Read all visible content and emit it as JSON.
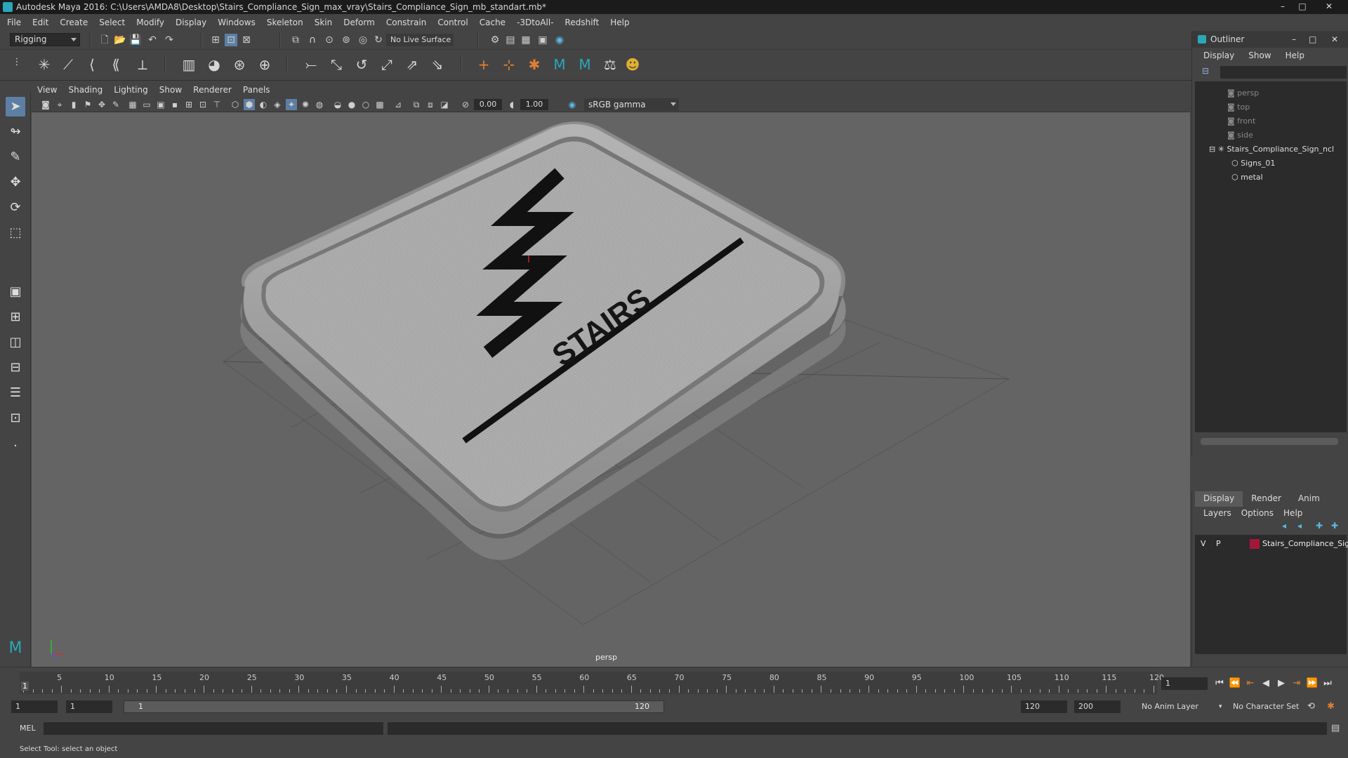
{
  "titlebar": {
    "title": "Autodesk Maya 2016: C:\\Users\\AMDA8\\Desktop\\Stairs_Compliance_Sign_max_vray\\Stairs_Compliance_Sign_mb_standart.mb*",
    "minimize": "–",
    "maximize": "□",
    "close": "✕"
  },
  "menubar": [
    "File",
    "Edit",
    "Create",
    "Select",
    "Modify",
    "Display",
    "Windows",
    "Skeleton",
    "Skin",
    "Deform",
    "Constrain",
    "Control",
    "Cache",
    "-3DtoAll-",
    "Redshift",
    "Help"
  ],
  "statusline": {
    "mode": "Rigging",
    "live_surface": "No Live Surface"
  },
  "viewport": {
    "menu": [
      "View",
      "Shading",
      "Lighting",
      "Show",
      "Renderer",
      "Panels"
    ],
    "exposure": "0.00",
    "gamma": "1.00",
    "color_space": "sRGB gamma",
    "camera": "persp",
    "sign_text": "STAIRS",
    "axis_x": "x",
    "axis_y": "y"
  },
  "outliner": {
    "title": "Outliner",
    "menu": [
      "Display",
      "Show",
      "Help"
    ],
    "items": [
      {
        "label": "persp",
        "dim": true
      },
      {
        "label": "top",
        "dim": true
      },
      {
        "label": "front",
        "dim": true
      },
      {
        "label": "side",
        "dim": true
      },
      {
        "label": "Stairs_Compliance_Sign_ncl",
        "dim": false
      },
      {
        "label": "Signs_01",
        "dim": false
      },
      {
        "label": "metal",
        "dim": false
      }
    ]
  },
  "layers": {
    "tabs": [
      "Display",
      "Render",
      "Anim"
    ],
    "menu": [
      "Layers",
      "Options",
      "Help"
    ],
    "layer": {
      "v": "V",
      "p": "P",
      "name": "Stairs_Compliance_Sig",
      "color": "#a3173a"
    }
  },
  "timeline": {
    "ticks": [
      "5",
      "10",
      "15",
      "20",
      "25",
      "30",
      "35",
      "40",
      "45",
      "50",
      "55",
      "60",
      "65",
      "70",
      "75",
      "80",
      "85",
      "90",
      "95",
      "100",
      "105",
      "110",
      "115",
      "120"
    ],
    "current_marker": "1",
    "current_frame": "1"
  },
  "range": {
    "start": "1",
    "playback_start": "1",
    "range_start": "1",
    "range_end": "120",
    "playback_end": "120",
    "end": "200",
    "anim_layer": "No Anim Layer",
    "char_set": "No Character Set"
  },
  "cmdline": {
    "label": "MEL"
  },
  "helpline": {
    "text": "Select Tool: select an object"
  },
  "colors": {
    "accent": "#5d7fa3",
    "layer": "#a3173a",
    "viewport_bg": "#646464"
  }
}
